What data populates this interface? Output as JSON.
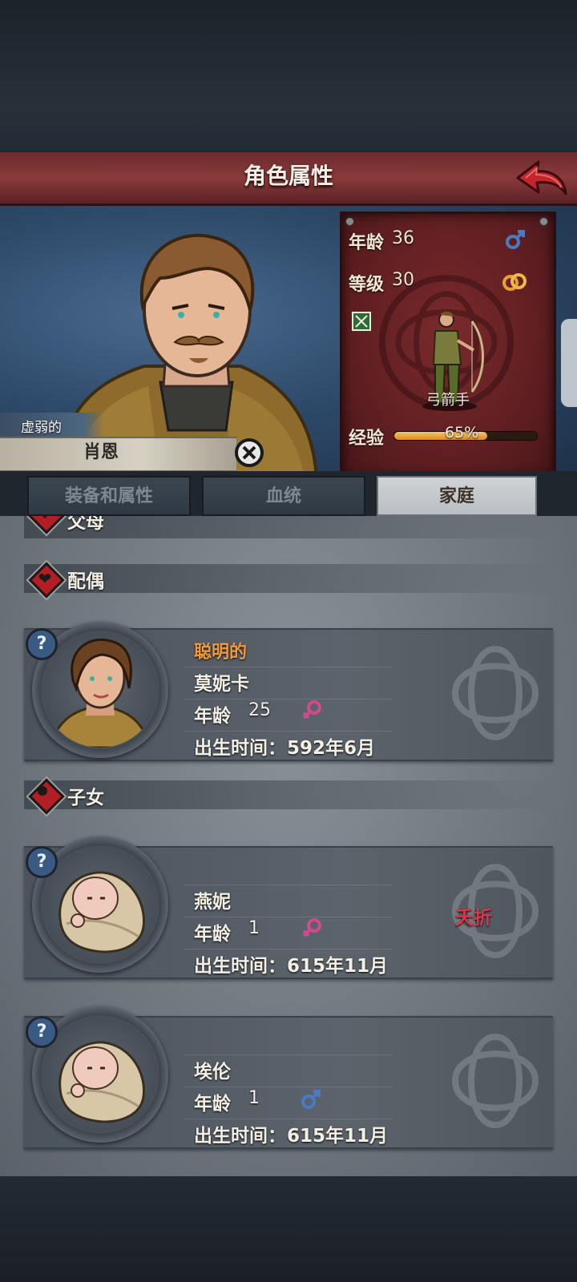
{
  "header": {
    "title": "角色属性"
  },
  "character": {
    "trait": "虚弱的",
    "name": "肖恩",
    "age_label": "年龄",
    "age": "36",
    "gender_icon": "male-icon",
    "level_label": "等级",
    "level": "30",
    "marriage_icon": "rings-icon",
    "class_name": "弓箭手",
    "exp_label": "经验",
    "exp_percent_text": "65%",
    "exp_fraction": 0.65
  },
  "tabs": [
    {
      "label": "装备和属性",
      "active": false
    },
    {
      "label": "血统",
      "active": false
    },
    {
      "label": "家庭",
      "active": true
    }
  ],
  "family": {
    "parents_title": "父母",
    "spouse_title": "配偶",
    "children_title": "子女",
    "spouse": {
      "trait": "聪明的",
      "name": "莫妮卡",
      "age_label": "年龄",
      "age": "25",
      "gender": "female",
      "birth_label": "出生时间：",
      "birth": "592年6月"
    },
    "children": [
      {
        "name": "燕妮",
        "age_label": "年龄",
        "age": "1",
        "gender": "female",
        "birth_label": "出生时间：",
        "birth": "615年11月",
        "status": "夭折"
      },
      {
        "name": "埃伦",
        "age_label": "年龄",
        "age": "1",
        "gender": "male",
        "birth_label": "出生时间：",
        "birth": "615年11月",
        "status": ""
      }
    ],
    "help_glyph": "?"
  },
  "colors": {
    "header_red": "#8a3a3a",
    "panel_red": "#5b1d20",
    "exp_orange": "#e8a030",
    "male_blue": "#4a7ac0",
    "female_pink": "#d04a8c",
    "deceased_red": "#e0364c",
    "trait_orange": "#f09a3c"
  }
}
